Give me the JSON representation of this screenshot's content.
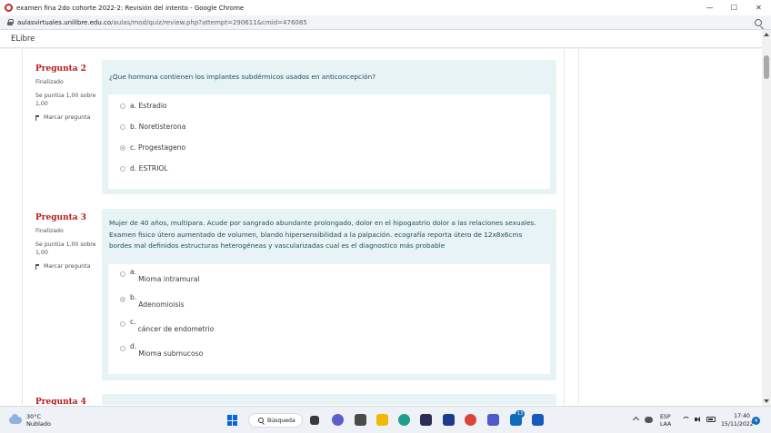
{
  "window": {
    "title": "examen fina 2do cohorte 2022-2: Revisión del intento - Google Chrome",
    "controls": {
      "minimize": "—",
      "maximize": "☐",
      "close": "✕"
    }
  },
  "address_bar": {
    "host": "aulasvirtuales.unilibre.edu.co",
    "path": "/aulas/mod/quiz/review.php?attempt=290611&cmid=476085"
  },
  "site": {
    "name": "ELibre"
  },
  "questions": [
    {
      "label": "Pregunta",
      "number": "2",
      "state": "Finalizado",
      "grade": "Se puntúa 1,00 sobre 1,00",
      "flag_label": "Marcar pregunta",
      "text": "¿Que hormona contienen los implantes subdérmicos usados en anticoncepción?",
      "options": [
        {
          "letter": "a.",
          "text": "Estradio",
          "checked": false
        },
        {
          "letter": "b.",
          "text": "Noretisterona",
          "checked": false
        },
        {
          "letter": "c.",
          "text": "Progestageno",
          "checked": true
        },
        {
          "letter": "d.",
          "text": "ESTRIOL",
          "checked": false
        }
      ]
    },
    {
      "label": "Pregunta",
      "number": "3",
      "state": "Finalizado",
      "grade": "Se puntúa 1,00 sobre 1,00",
      "flag_label": "Marcar pregunta",
      "text": "Mujer de 40 años, multipara. Acude por sangrado abundante prolongado, dolor en el hipogastrio dolor a las relaciones sexuales. Examen fisico útero aumentado de volumen, blando hipersensibilidad a la palpación. ecografía reporta útero de 12x8x6cms bordes mal definidos estructuras heterogéneas y vascularizadas cual es el diagnostico más probable",
      "options": [
        {
          "letter": "a.",
          "text": "Mioma intramural",
          "checked": false
        },
        {
          "letter": "b.",
          "text": "Adenomioisis",
          "checked": true
        },
        {
          "letter": "c.",
          "text": "cáncer de endometrio",
          "checked": false
        },
        {
          "letter": "d.",
          "text": "Mioma submucoso",
          "checked": false
        }
      ]
    },
    {
      "label": "Pregunta",
      "number": "4"
    }
  ],
  "taskbar": {
    "weather_temp": "30°C",
    "weather_desc": "Nublado",
    "search_label": "Búsqueda",
    "mail_badge": "13",
    "lang_top": "ESP",
    "lang_bottom": "LAA",
    "time": "17:40",
    "date": "15/11/2022",
    "notifications": "4"
  }
}
